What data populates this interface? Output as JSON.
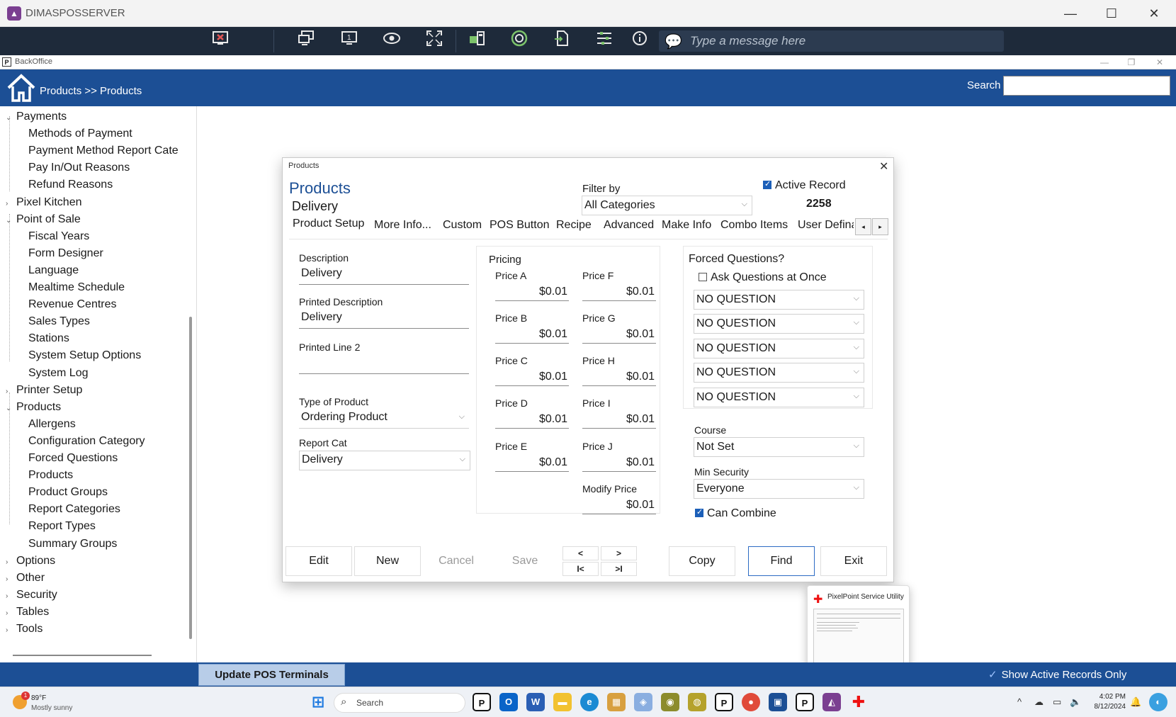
{
  "window": {
    "title": "DIMASPOSSERVER",
    "minimize": "—",
    "maximize": "☐",
    "close": "✕"
  },
  "remote_toolbar": {
    "message_placeholder": "Type a message here"
  },
  "backoffice": {
    "title": "BackOffice",
    "breadcrumb": "Products >> Products",
    "search_label": "Search",
    "search_value": ""
  },
  "tree": {
    "items": [
      {
        "label": "Payments",
        "level": 0,
        "expanded": true
      },
      {
        "label": "Methods of Payment",
        "level": 1
      },
      {
        "label": "Payment Method Report Cate",
        "level": 1
      },
      {
        "label": "Pay In/Out Reasons",
        "level": 1
      },
      {
        "label": "Refund Reasons",
        "level": 1
      },
      {
        "label": "Pixel Kitchen",
        "level": 0,
        "expanded": false
      },
      {
        "label": "Point of Sale",
        "level": 0,
        "expanded": true
      },
      {
        "label": "Fiscal Years",
        "level": 1
      },
      {
        "label": "Form Designer",
        "level": 1
      },
      {
        "label": "Language",
        "level": 1
      },
      {
        "label": "Mealtime Schedule",
        "level": 1
      },
      {
        "label": "Revenue Centres",
        "level": 1
      },
      {
        "label": "Sales Types",
        "level": 1
      },
      {
        "label": "Stations",
        "level": 1
      },
      {
        "label": "System Setup Options",
        "level": 1
      },
      {
        "label": "System Log",
        "level": 1
      },
      {
        "label": "Printer Setup",
        "level": 0,
        "expanded": false
      },
      {
        "label": "Products",
        "level": 0,
        "expanded": true
      },
      {
        "label": "Allergens",
        "level": 1
      },
      {
        "label": "Configuration Category",
        "level": 1
      },
      {
        "label": "Forced Questions",
        "level": 1
      },
      {
        "label": "Products",
        "level": 1
      },
      {
        "label": "Product Groups",
        "level": 1
      },
      {
        "label": "Report Categories",
        "level": 1
      },
      {
        "label": "Report Types",
        "level": 1
      },
      {
        "label": "Summary Groups",
        "level": 1
      },
      {
        "label": "Options",
        "level": 0,
        "expanded": false
      },
      {
        "label": "Other",
        "level": 0,
        "expanded": false
      },
      {
        "label": "Security",
        "level": 0,
        "expanded": false
      },
      {
        "label": "Tables",
        "level": 0,
        "expanded": false
      },
      {
        "label": "Tools",
        "level": 0,
        "expanded": false
      }
    ]
  },
  "dialog": {
    "caption": "Products",
    "heading": "Products",
    "record_name": "Delivery",
    "filter_label": "Filter by",
    "filter_value": "All Categories",
    "active_record_label": "Active Record",
    "active_record_checked": true,
    "record_number": "2258",
    "tabs": [
      "Product Setup",
      "More Info...",
      "Custom",
      "POS Button",
      "Recipe",
      "Advanced",
      "Make Info",
      "Combo Items",
      "User Defina"
    ],
    "tab_prev": "◂",
    "tab_next": "▸",
    "description_label": "Description",
    "description_value": "Delivery",
    "printed_description_label": "Printed Description",
    "printed_description_value": "Delivery",
    "printed_line2_label": "Printed Line 2",
    "printed_line2_value": "",
    "type_label": "Type of Product",
    "type_value": "Ordering Product",
    "report_cat_label": "Report Cat",
    "report_cat_value": "Delivery",
    "pricing_label": "Pricing",
    "prices": [
      {
        "label": "Price A",
        "value": "$0.01"
      },
      {
        "label": "Price F",
        "value": "$0.01"
      },
      {
        "label": "Price B",
        "value": "$0.01"
      },
      {
        "label": "Price G",
        "value": "$0.01"
      },
      {
        "label": "Price C",
        "value": "$0.01"
      },
      {
        "label": "Price H",
        "value": "$0.01"
      },
      {
        "label": "Price D",
        "value": "$0.01"
      },
      {
        "label": "Price I",
        "value": "$0.01"
      },
      {
        "label": "Price E",
        "value": "$0.01"
      },
      {
        "label": "Price J",
        "value": "$0.01"
      }
    ],
    "modify_price_label": "Modify Price",
    "modify_price_value": "$0.01",
    "forced_questions_label": "Forced Questions?",
    "ask_at_once_label": "Ask Questions at Once",
    "forced_questions": [
      "NO QUESTION",
      "NO QUESTION",
      "NO QUESTION",
      "NO QUESTION",
      "NO QUESTION"
    ],
    "course_label": "Course",
    "course_value": "Not Set",
    "min_security_label": "Min Security",
    "min_security_value": "Everyone",
    "can_combine_label": "Can Combine",
    "buttons": {
      "edit": "Edit",
      "new": "New",
      "cancel": "Cancel",
      "save": "Save",
      "prev": "<",
      "next": ">",
      "first": "I<",
      "last": ">I",
      "copy": "Copy",
      "find": "Find",
      "exit": "Exit"
    }
  },
  "service_utility": {
    "title": "PixelPoint Service Utility"
  },
  "statusbar": {
    "update_button": "Update POS Terminals",
    "show_active_label": "Show Active Records Only"
  },
  "taskbar": {
    "weather_temp": "89°F",
    "weather_condition": "Mostly sunny",
    "weather_badge": "1",
    "search_text": "Search",
    "clock_time": "4:02 PM",
    "clock_date": "8/12/2024"
  },
  "colors": {
    "header_blue": "#1c4f95",
    "link_blue": "#1c4f95",
    "toolbar_dark": "#1e2a3a"
  }
}
